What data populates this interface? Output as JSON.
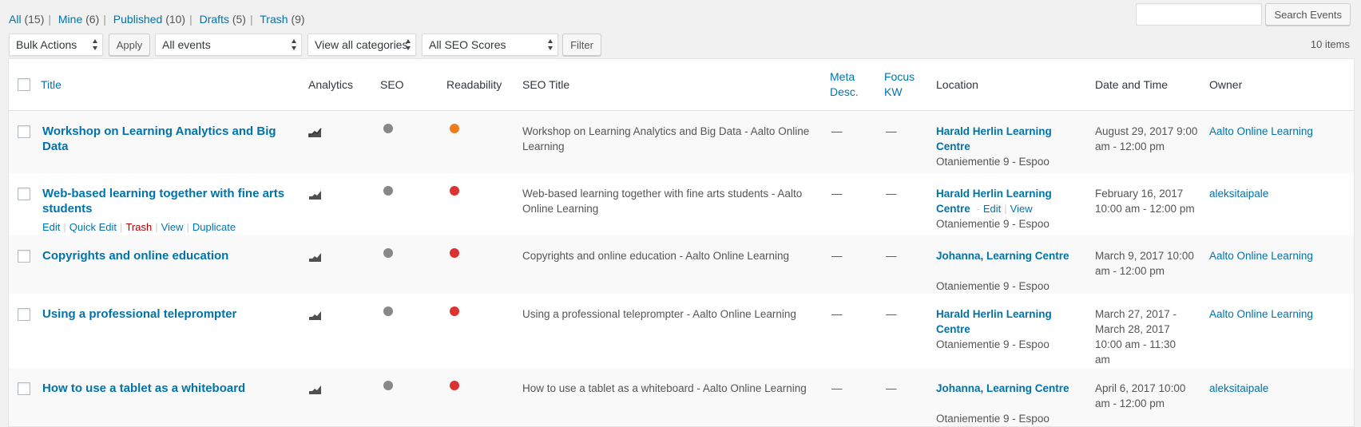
{
  "views": [
    {
      "label": "All",
      "count": "(15)"
    },
    {
      "label": "Mine",
      "count": "(6)"
    },
    {
      "label": "Published",
      "count": "(10)"
    },
    {
      "label": "Drafts",
      "count": "(5)"
    },
    {
      "label": "Trash",
      "count": "(9)"
    }
  ],
  "search": {
    "value": "",
    "button": "Search Events"
  },
  "filters": {
    "bulk_actions": "Bulk Actions",
    "apply": "Apply",
    "events": "All events",
    "categories": "View all categories",
    "seo_scores": "All SEO Scores",
    "filter": "Filter"
  },
  "items_count": "10 items",
  "columns": {
    "title": "Title",
    "analytics": "Analytics",
    "seo": "SEO",
    "readability": "Readability",
    "seo_title": "SEO Title",
    "meta_desc": "Meta Desc.",
    "focus_kw": "Focus KW",
    "location": "Location",
    "date": "Date and Time",
    "owner": "Owner"
  },
  "row_actions": {
    "edit": "Edit",
    "quick_edit": "Quick Edit",
    "trash": "Trash",
    "view": "View",
    "duplicate": "Duplicate"
  },
  "location_actions": {
    "edit": "Edit",
    "view": "View"
  },
  "colors": {
    "seo_gray": "#888888",
    "orange": "#ee7c1b",
    "red": "#dc3232"
  },
  "rows": [
    {
      "title": "Workshop on Learning Analytics and Big Data",
      "seo_color": "#888888",
      "readability_color": "#ee7c1b",
      "seo_title": "Workshop on Learning Analytics and Big Data - Aalto Online Learning",
      "meta_desc": "—",
      "focus_kw": "—",
      "location_name": "Harald Herlin Learning Centre",
      "location_address": "Otaniementie 9 - Espoo",
      "date": "August 29, 2017 9:00 am - 12:00 pm",
      "owner": "Aalto Online Learning"
    },
    {
      "title": "Web-based learning together with fine arts students",
      "seo_color": "#888888",
      "readability_color": "#dc3232",
      "seo_title": "Web-based learning together with fine arts students - Aalto Online Learning",
      "meta_desc": "—",
      "focus_kw": "—",
      "location_name": "Harald Herlin Learning Centre",
      "location_address": "Otaniementie 9 - Espoo",
      "date": "February 16, 2017 10:00 am - 12:00 pm",
      "owner": "aleksitaipale"
    },
    {
      "title": "Copyrights and online education",
      "seo_color": "#888888",
      "readability_color": "#dc3232",
      "seo_title": "Copyrights and online education - Aalto Online Learning",
      "meta_desc": "—",
      "focus_kw": "—",
      "location_name": "Johanna, Learning Centre",
      "location_address": "Otaniementie 9 - Espoo",
      "date": "March 9, 2017 10:00 am - 12:00 pm",
      "owner": "Aalto Online Learning"
    },
    {
      "title": "Using a professional teleprompter",
      "seo_color": "#888888",
      "readability_color": "#dc3232",
      "seo_title": "Using a professional teleprompter - Aalto Online Learning",
      "meta_desc": "—",
      "focus_kw": "—",
      "location_name": "Harald Herlin Learning Centre",
      "location_address": "Otaniementie 9 - Espoo",
      "date": "March 27, 2017 - March 28, 2017 10:00 am - 11:30 am",
      "owner": "Aalto Online Learning"
    },
    {
      "title": "How to use a tablet as a whiteboard",
      "seo_color": "#888888",
      "readability_color": "#dc3232",
      "seo_title": "How to use a tablet as a whiteboard - Aalto Online Learning",
      "meta_desc": "—",
      "focus_kw": "—",
      "location_name": "Johanna, Learning Centre",
      "location_address": "Otaniementie 9 - Espoo",
      "date": "April 6, 2017 10:00 am - 12:00 pm",
      "owner": "aleksitaipale"
    }
  ]
}
